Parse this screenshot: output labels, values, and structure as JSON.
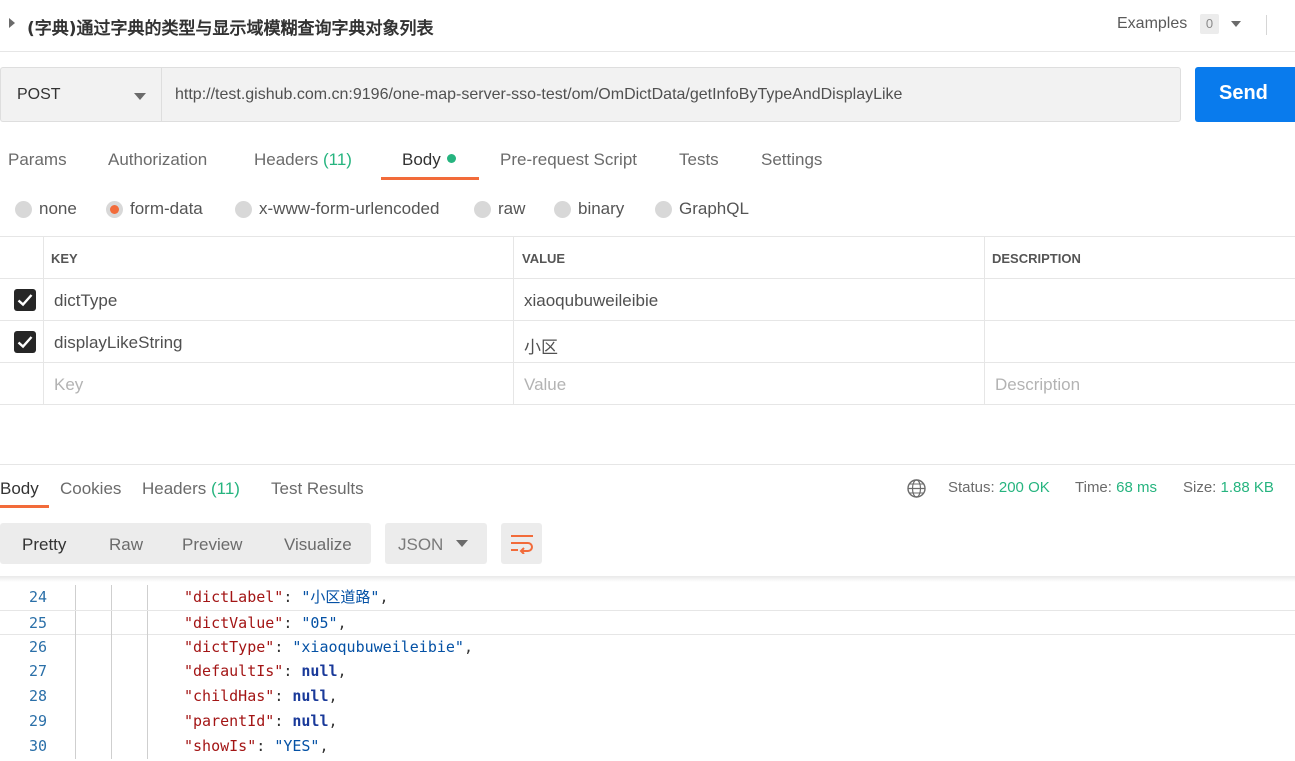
{
  "titlebar": {
    "title": "(字典)通过字典的类型与显示域模糊查询字典对象列表",
    "examples_label": "Examples",
    "examples_count": "0"
  },
  "request": {
    "method": "POST",
    "url": "http://test.gishub.com.cn:9196/one-map-server-sso-test/om/OmDictData/getInfoByTypeAndDisplayLike",
    "send_label": "Send"
  },
  "request_tabs": [
    {
      "label": "Params",
      "count": ""
    },
    {
      "label": "Authorization",
      "count": ""
    },
    {
      "label": "Headers",
      "count": "(11)"
    },
    {
      "label": "Body",
      "count": ""
    },
    {
      "label": "Pre-request Script",
      "count": ""
    },
    {
      "label": "Tests",
      "count": ""
    },
    {
      "label": "Settings",
      "count": ""
    }
  ],
  "body_types": [
    "none",
    "form-data",
    "x-www-form-urlencoded",
    "raw",
    "binary",
    "GraphQL"
  ],
  "params_table": {
    "headers": [
      "KEY",
      "VALUE",
      "DESCRIPTION"
    ],
    "rows": [
      {
        "key": "dictType",
        "value": "xiaoqubuweileibie",
        "description": "",
        "checked": true
      },
      {
        "key": "displayLikeString",
        "value": "小区",
        "description": "",
        "checked": true
      }
    ],
    "placeholders": {
      "key": "Key",
      "value": "Value",
      "description": "Description"
    }
  },
  "response_tabs": [
    {
      "label": "Body",
      "count": ""
    },
    {
      "label": "Cookies",
      "count": ""
    },
    {
      "label": "Headers",
      "count": "(11)"
    },
    {
      "label": "Test Results",
      "count": ""
    }
  ],
  "response_status": {
    "status_label": "Status:",
    "status_value": "200 OK",
    "time_label": "Time:",
    "time_value": "68 ms",
    "size_label": "Size:",
    "size_value": "1.88 KB"
  },
  "view_options": [
    "Pretty",
    "Raw",
    "Preview",
    "Visualize"
  ],
  "format": "JSON",
  "code_lines": [
    {
      "num": "24",
      "key": "\"dictLabel\"",
      "value": "\"小区道路\"",
      "vtype": "s"
    },
    {
      "num": "25",
      "key": "\"dictValue\"",
      "value": "\"05\"",
      "vtype": "s"
    },
    {
      "num": "26",
      "key": "\"dictType\"",
      "value": "\"xiaoqubuweileibie\"",
      "vtype": "s"
    },
    {
      "num": "27",
      "key": "\"defaultIs\"",
      "value": "null",
      "vtype": "n"
    },
    {
      "num": "28",
      "key": "\"childHas\"",
      "value": "null",
      "vtype": "n"
    },
    {
      "num": "29",
      "key": "\"parentId\"",
      "value": "null",
      "vtype": "n"
    },
    {
      "num": "30",
      "key": "\"showIs\"",
      "value": "\"YES\"",
      "vtype": "s"
    }
  ],
  "colors": {
    "accent_orange": "#f26b3a",
    "send_blue": "#097bed",
    "success_green": "#26b47f"
  }
}
